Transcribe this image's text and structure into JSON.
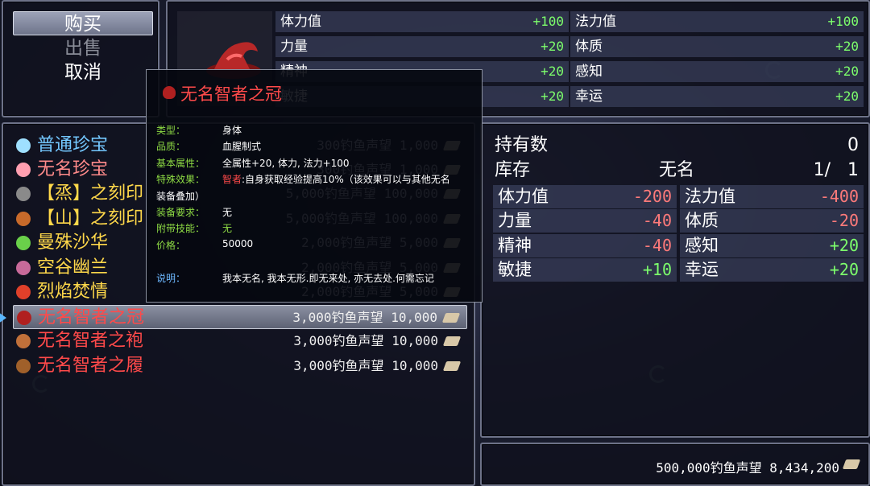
{
  "commands": [
    {
      "label": "购买",
      "selected": true,
      "disabled": false
    },
    {
      "label": "出售",
      "selected": false,
      "disabled": true
    },
    {
      "label": "取消",
      "selected": false,
      "disabled": false
    }
  ],
  "equip_stats": [
    {
      "label": "体力值",
      "value": "+100"
    },
    {
      "label": "法力值",
      "value": "+100"
    },
    {
      "label": "力量",
      "value": "+20"
    },
    {
      "label": "体质",
      "value": "+20"
    },
    {
      "label": "精神",
      "value": "+20"
    },
    {
      "label": "感知",
      "value": "+20"
    },
    {
      "label": "敏捷",
      "value": "+20"
    },
    {
      "label": "幸运",
      "value": "+20"
    }
  ],
  "items": [
    {
      "name": "普通珍宝",
      "price": "300钓鱼声望 1,000",
      "color": "#74c8ff",
      "icon_color": "#9fe0ff"
    },
    {
      "name": "无名珍宝",
      "price": "300钓鱼声望 1,000",
      "color": "#ff8a8a",
      "icon_color": "#ff9fb0"
    },
    {
      "name": "【烝】之刻印",
      "price": "5,000钓鱼声望 100,000",
      "color": "#ffd84a",
      "icon_color": "#8a8a8a"
    },
    {
      "name": "【山】之刻印",
      "price": "5,000钓鱼声望 100,000",
      "color": "#ffd84a",
      "icon_color": "#c86a2a"
    },
    {
      "name": "曼殊沙华",
      "price": "2,000钓鱼声望 5,000",
      "color": "#ffd84a",
      "icon_color": "#6ad04a"
    },
    {
      "name": "空谷幽兰",
      "price": "2,000钓鱼声望 5,000",
      "color": "#ffd84a",
      "icon_color": "#c86a9a"
    },
    {
      "name": "烈焰焚情",
      "price": "2,000钓鱼声望 5,000",
      "color": "#ffd84a",
      "icon_color": "#e0402a"
    },
    {
      "name": "无名智者之冠",
      "price": "3,000钓鱼声望 10,000",
      "color": "#ff4a4a",
      "icon_color": "#b02020"
    },
    {
      "name": "无名智者之袍",
      "price": "3,000钓鱼声望 10,000",
      "color": "#ff4a4a",
      "icon_color": "#c0703a"
    },
    {
      "name": "无名智者之履",
      "price": "3,000钓鱼声望 10,000",
      "color": "#ff4a4a",
      "icon_color": "#a0602a"
    }
  ],
  "detail": {
    "owned_label": "持有数",
    "owned_value": "0",
    "stock_label": "库存",
    "stock_name": "无名",
    "stock_value": "1/   1",
    "stats": [
      {
        "label": "体力值",
        "value": "-200",
        "color": "#ff7a7a"
      },
      {
        "label": "法力值",
        "value": "-400",
        "color": "#ff7a7a"
      },
      {
        "label": "力量",
        "value": "-40",
        "color": "#ff7a7a"
      },
      {
        "label": "体质",
        "value": "-20",
        "color": "#ff7a7a"
      },
      {
        "label": "精神",
        "value": "-40",
        "color": "#ff7a7a"
      },
      {
        "label": "感知",
        "value": "+20",
        "color": "#7dff6c"
      },
      {
        "label": "敏捷",
        "value": "+10",
        "color": "#7dff6c"
      },
      {
        "label": "幸运",
        "value": "+20",
        "color": "#7dff6c"
      }
    ]
  },
  "gold": "500,000钓鱼声望 8,434,200",
  "tooltip": {
    "title": "无名智者之冠",
    "rows": [
      {
        "key": "类型：",
        "value": "身体"
      },
      {
        "key": "品质：",
        "value": "血腥制式"
      },
      {
        "key": "基本属性：",
        "value": "全属性+20, 体力, 法力+100"
      },
      {
        "key": "特殊效果：",
        "value_prefix": "智者",
        "value": ":自身获取经验提高10%（该效果可以与其他无名"
      },
      {
        "key": "",
        "value": "装备叠加）"
      },
      {
        "key": "装备要求：",
        "value": "无"
      },
      {
        "key": "附带技能：",
        "value": "无"
      },
      {
        "key": "价格：",
        "value": "50000"
      },
      {
        "key": "说明：",
        "value": "我本无名, 我本无形.即无来处, 亦无去处.何需忘记"
      }
    ]
  }
}
